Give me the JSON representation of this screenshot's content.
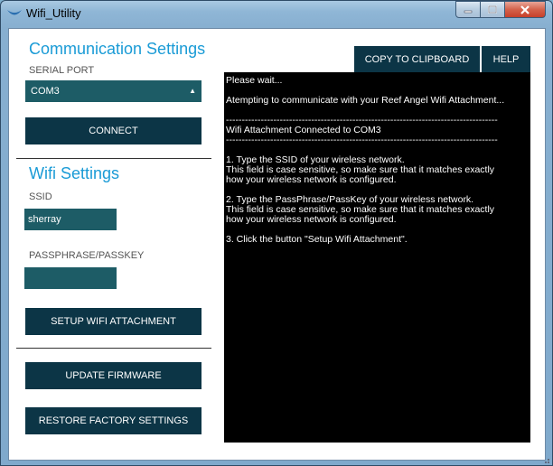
{
  "window": {
    "title": "Wifi_Utility",
    "minimize_symbol": "—",
    "maximize_symbol": "☐",
    "close_symbol": "✕"
  },
  "communication": {
    "heading": "Communication Settings",
    "serial_port_label": "SERIAL PORT",
    "serial_port_value": "COM3",
    "connect_label": "CONNECT"
  },
  "wifi": {
    "heading": "Wifi Settings",
    "ssid_label": "SSID",
    "ssid_value": "sherray",
    "passphrase_label": "PASSPHRASE/PASSKEY",
    "passphrase_value": "",
    "setup_label": "SETUP WIFI ATTACHMENT"
  },
  "actions": {
    "update_label": "UPDATE FIRMWARE",
    "restore_label": "RESTORE FACTORY SETTINGS",
    "copy_label": "COPY TO CLIPBOARD",
    "help_label": "HELP"
  },
  "console": {
    "lines": [
      "Please wait...",
      "",
      "Atempting to communicate with your Reef Angel Wifi Attachment...",
      "",
      "--------------------------------------------------------------------------------------",
      "Wifi Attachment Connected to COM3",
      "--------------------------------------------------------------------------------------",
      "",
      "1. Type the SSID of your wireless network.",
      "This field is case sensitive, so make sure that it matches exactly",
      "how your wireless network is configured.",
      "",
      "2. Type the PassPhrase/PassKey of your wireless network.",
      "This field is case sensitive, so make sure that it matches exactly",
      "how your wireless network is configured.",
      "",
      "3. Click the button \"Setup Wifi Attachment\"."
    ]
  },
  "colors": {
    "heading": "#1a9bd6",
    "button": "#0c3546",
    "field": "#1d5c66",
    "console_bg": "#000000"
  }
}
